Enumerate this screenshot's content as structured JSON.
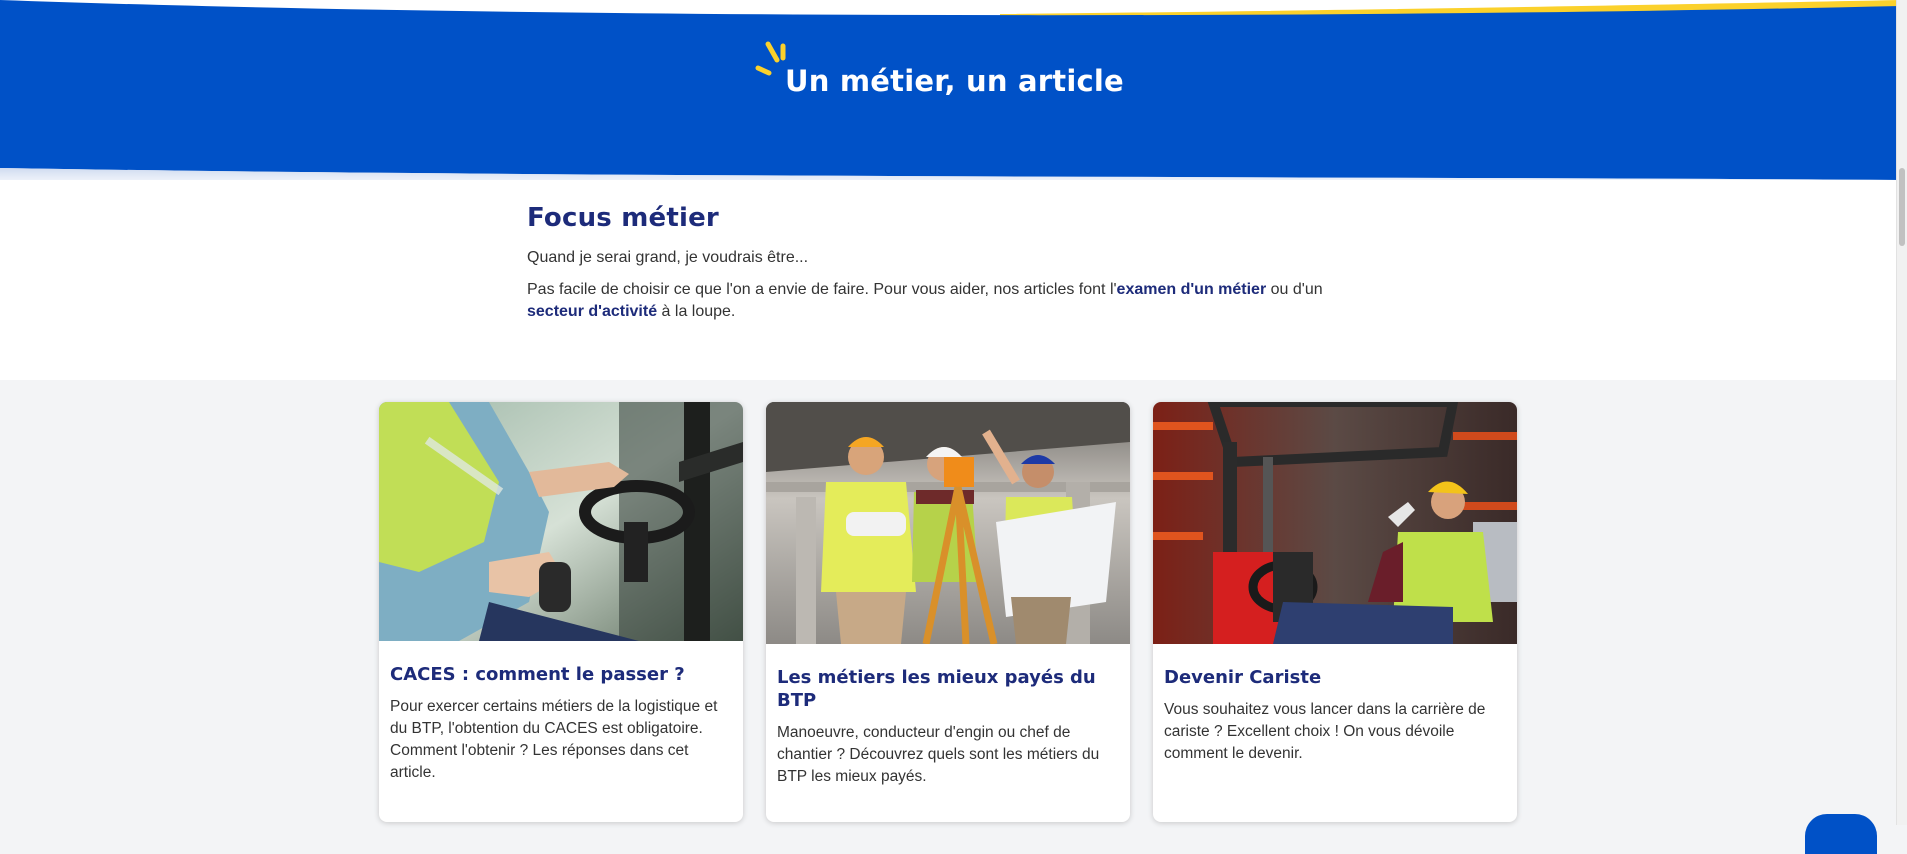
{
  "banner": {
    "title": "Un métier, un article",
    "colors": {
      "background": "#0051c7",
      "accent": "#fbd12b"
    },
    "icon": "sparkle-icon"
  },
  "focus": {
    "heading": "Focus métier",
    "intro": "Quand je serai grand, je voudrais être...",
    "para_before": "Pas facile de choisir ce que l'on a envie de faire. Pour vous aider, nos articles font l'",
    "link1": "examen d'un métier",
    "para_middle": " ou d'un ",
    "link2": "secteur d'activité",
    "para_after": " à la loupe."
  },
  "cards": [
    {
      "title": "CACES : comment le passer ?",
      "description": "Pour exercer certains métiers de la logistique et du BTP, l'obtention du CACES est obligatoire. Comment l'obtenir ? Les réponses dans cet article.",
      "image": "forklift-driver-hands-photo"
    },
    {
      "title": "Les métiers les mieux payés du BTP",
      "description": "Manoeuvre, conducteur d'engin ou chef de chantier ? Découvrez quels sont les métiers du BTP les mieux payés.",
      "image": "construction-workers-surveying-photo"
    },
    {
      "title": "Devenir Cariste",
      "description": "Vous souhaitez vous lancer dans la carrière de cariste ? Excellent choix ! On vous dévoile comment le devenir.",
      "image": "cariste-on-forklift-photo"
    }
  ]
}
